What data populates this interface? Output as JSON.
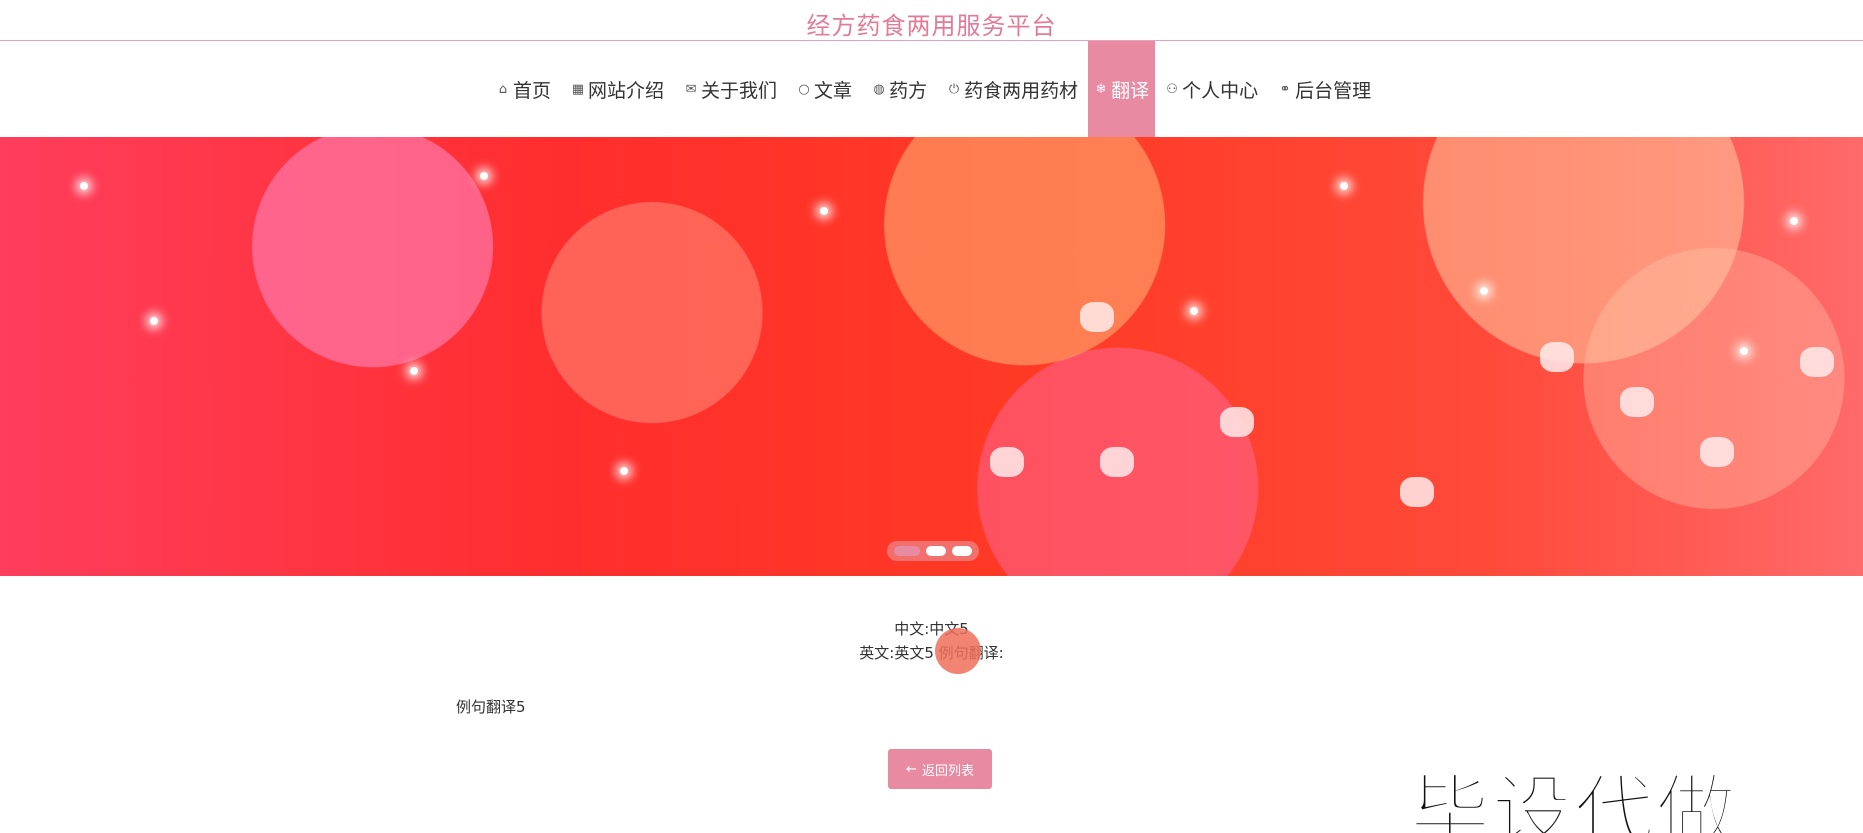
{
  "site": {
    "title": "经方药食两用服务平台"
  },
  "nav": {
    "items": [
      {
        "icon": "home-icon",
        "glyph": "⌂",
        "label": "首页"
      },
      {
        "icon": "grid-icon",
        "glyph": "▦",
        "label": "网站介绍"
      },
      {
        "icon": "mail-icon",
        "glyph": "✉",
        "label": "关于我们"
      },
      {
        "icon": "circle-icon",
        "glyph": "○",
        "label": "文章"
      },
      {
        "icon": "globe-icon",
        "glyph": "◍",
        "label": "药方"
      },
      {
        "icon": "power-icon",
        "glyph": "⏻",
        "label": "药食两用药材"
      },
      {
        "icon": "snowflake-icon",
        "glyph": "❄",
        "label": "翻译"
      },
      {
        "icon": "user-icon",
        "glyph": "⚇",
        "label": "个人中心"
      },
      {
        "icon": "link-icon",
        "glyph": "⚭",
        "label": "后台管理"
      }
    ],
    "active_index": 6
  },
  "detail": {
    "chinese_line": "中文:中文5",
    "english_line": "英文:英文5  例句翻译:",
    "sentence_translation": "例句翻译5"
  },
  "actions": {
    "back_label": "返回列表"
  },
  "watermark": {
    "text": "毕设代做"
  },
  "colors": {
    "accent": "#e88aa2",
    "title": "#e27b98"
  }
}
